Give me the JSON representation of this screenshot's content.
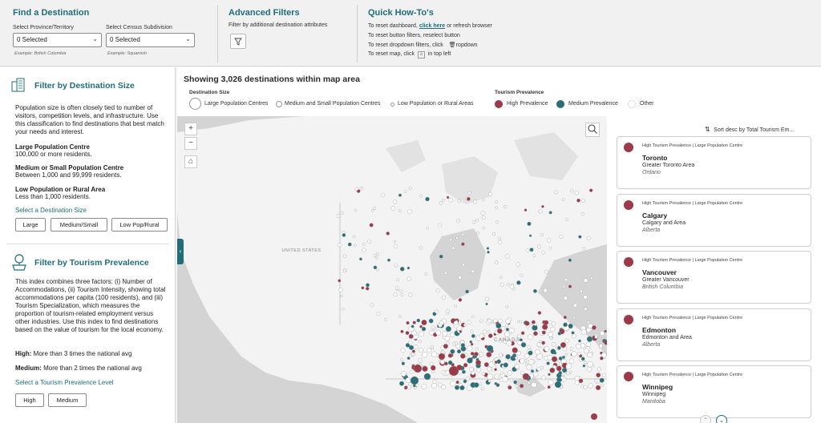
{
  "topbar": {
    "find": {
      "title": "Find a Destination",
      "province_label": "Select Province/Territory",
      "province_value": "0 Selected",
      "province_example": "Example: British Columbia",
      "csd_label": "Select Census Subdivision",
      "csd_value": "0 Selected",
      "csd_example": "Example: Squamish"
    },
    "advanced": {
      "title": "Advanced Filters",
      "desc": "Filter by additional destination attributes"
    },
    "howto": {
      "title": "Quick How-To's",
      "line1_pre": "To reset dashboard, ",
      "line1_link": "click here",
      "line1_post": " or refresh browser",
      "line2": "To reset button filters, reselect button",
      "line3_pre": "To reset dropdown filters, click",
      "line3_post": "ropdown",
      "line4_pre": "To reset map, click",
      "line4_post": "in top left"
    }
  },
  "left": {
    "size": {
      "title": "Filter by Destination Size",
      "desc": "Population size is often closely tied to number of visitors, competition levels, and infrastructure. Use this classification to find destinations that best match your needs and interest.",
      "large_title": "Large Population Centre",
      "large_desc": "100,000 or more residents.",
      "medium_title": "Medium or Small Population Centre",
      "medium_desc": "Between 1,000 and 99,999 residents.",
      "low_title": "Low Population or Rural Area",
      "low_desc": "Less than 1,000 residents.",
      "select_label": "Select a Destination Size",
      "buttons": [
        "Large",
        "Medium/Small",
        "Low Pop/Rural"
      ]
    },
    "tourism": {
      "title": "Filter by Tourism Prevalence",
      "desc": "This index combines three factors: (i) Number of Accommodations, (ii) Tourism Intensity, showing total accommodations per capita (100 residents), and (iii) Tourism Specialization, which measures the proportion of tourism-related employment versus other industries. Use this index to find destinations based on the value of tourism for the local economy.",
      "high_label": "High:",
      "high_desc": " More than 3 times the national avg",
      "medium_label": "Medium:",
      "medium_desc": " More than 2 times the national avg",
      "select_label": "Select a Tourism Prevalence Level",
      "buttons": [
        "High",
        "Medium"
      ]
    }
  },
  "main": {
    "title": "Showing 3,026 destinations within map area",
    "size_legend_title": "Destination Size",
    "size_legend": [
      "Large Population Centres",
      "Medium and Small Population Centres",
      "Low Population or Rural Areas"
    ],
    "prev_legend_title": "Tourism Prevalence",
    "prev_legend": [
      "High Prevalence",
      "Medium Prevalence",
      "Other"
    ],
    "colors": {
      "high": "#9b3a49",
      "medium": "#2a6f78",
      "other": "#ffffff"
    }
  },
  "map": {
    "label_us": "UNITED STATES",
    "label_canada": "CANADA",
    "zoom_in": "+",
    "zoom_out": "−"
  },
  "list": {
    "sort_label": "Sort desc by Total Tourism Em...",
    "cards": [
      {
        "tag": "High Tourism Prevalence | Large Population Centre",
        "name": "Toronto",
        "area": "Greater Toronto Area",
        "province": "Ontario"
      },
      {
        "tag": "High Tourism Prevalence | Large Population Centre",
        "name": "Calgary",
        "area": "Calgary and Area",
        "province": "Alberta"
      },
      {
        "tag": "High Tourism Prevalence | Large Population Centre",
        "name": "Vancouver",
        "area": "Greater Vancouver",
        "province": "British Columbia"
      },
      {
        "tag": "High Tourism Prevalence | Large Population Centre",
        "name": "Edmonton",
        "area": "Edmonton and Area",
        "province": "Alberta"
      },
      {
        "tag": "High Tourism Prevalence | Large Population Centre",
        "name": "Winnipeg",
        "area": "Winnipeg",
        "province": "Manitoba"
      }
    ]
  }
}
